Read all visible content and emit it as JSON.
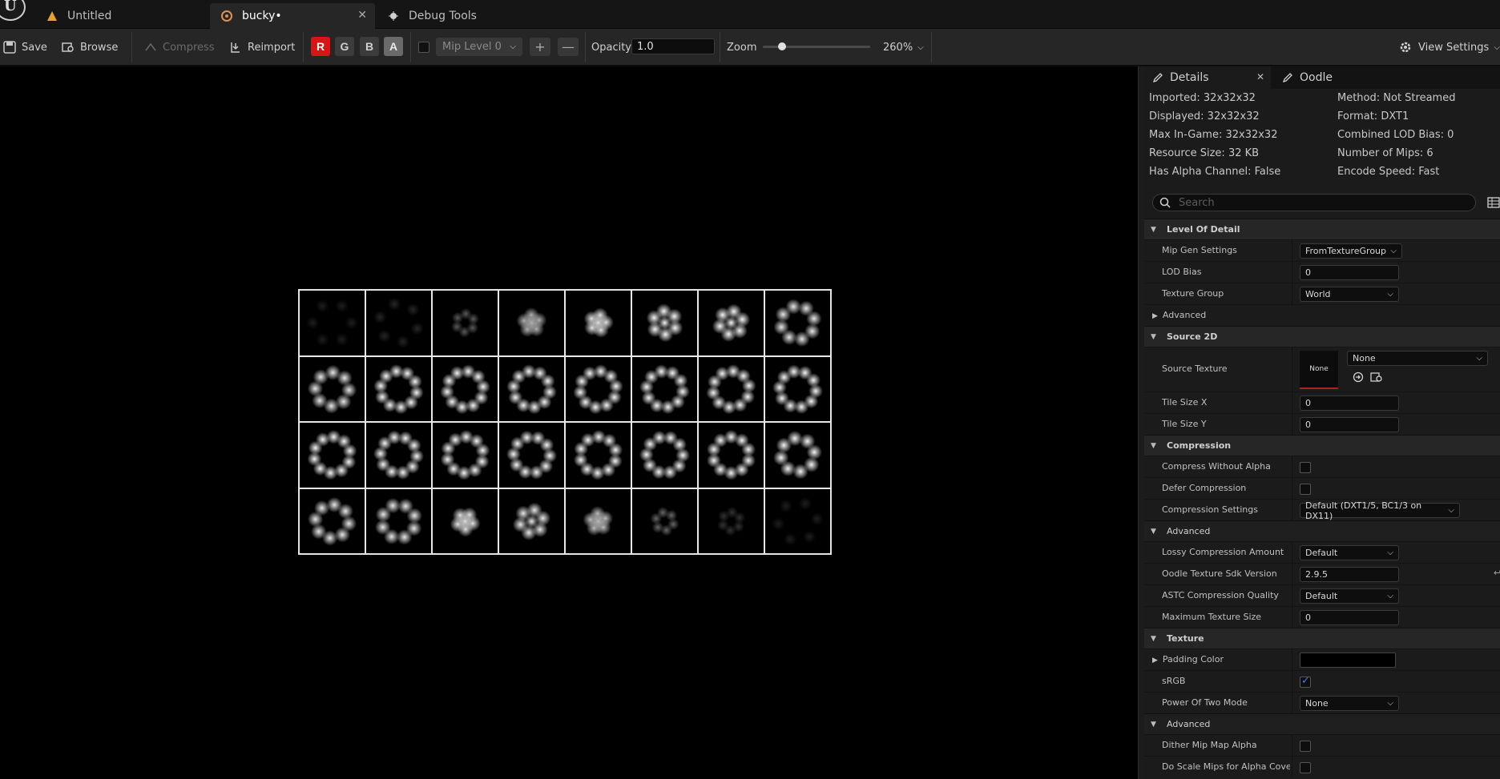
{
  "tabs": [
    {
      "label": "Untitled"
    },
    {
      "label": "bucky•"
    },
    {
      "label": "Debug Tools"
    }
  ],
  "toolbar": {
    "save": "Save",
    "browse": "Browse",
    "compress": "Compress",
    "reimport": "Reimport",
    "channels": [
      "R",
      "G",
      "B",
      "A"
    ],
    "mip_level": "Mip Level 0",
    "opacity_label": "Opacity",
    "opacity_value": "1.0",
    "zoom_label": "Zoom",
    "zoom_slider_fraction": 0.18,
    "zoom_value": "260%",
    "view_settings": "View Settings"
  },
  "colors": {
    "accent_blue": "#2a88ff",
    "channel_r": "#d81414",
    "panel_bg": "#1b1b1b",
    "viewport_bg": "#000000"
  },
  "panel": {
    "tabs": [
      "Details",
      "Oodle"
    ],
    "info_left": [
      "Imported: 32x32x32",
      "Displayed: 32x32x32",
      "Max In-Game: 32x32x32",
      "Resource Size: 32 KB",
      "Has Alpha Channel: False"
    ],
    "info_right": [
      "Method: Not Streamed",
      "Format: DXT1",
      "Combined LOD Bias: 0",
      "Number of Mips: 6",
      "Encode Speed: Fast"
    ],
    "search_placeholder": "Search",
    "sections": {
      "lod": {
        "title": "Level Of Detail",
        "mip_gen_label": "Mip Gen Settings",
        "mip_gen_value": "FromTextureGroup",
        "lod_bias_label": "LOD Bias",
        "lod_bias_value": "0",
        "texture_group_label": "Texture Group",
        "texture_group_value": "World",
        "advanced": "Advanced"
      },
      "source2d": {
        "title": "Source 2D",
        "source_texture_label": "Source Texture",
        "thumb": "None",
        "source_value": "None",
        "tile_x_label": "Tile Size X",
        "tile_x_value": "0",
        "tile_y_label": "Tile Size Y",
        "tile_y_value": "0"
      },
      "compression": {
        "title": "Compression",
        "without_alpha": "Compress Without Alpha",
        "defer": "Defer Compression",
        "settings_label": "Compression Settings",
        "settings_value": "Default (DXT1/5, BC1/3 on DX11)",
        "advanced": "Advanced",
        "lossy_label": "Lossy Compression Amount",
        "lossy_value": "Default",
        "oodle_label": "Oodle Texture Sdk Version",
        "oodle_value": "2.9.5",
        "astc_label": "ASTC Compression Quality",
        "astc_value": "Default",
        "max_size_label": "Maximum Texture Size",
        "max_size_value": "0"
      },
      "texture": {
        "title": "Texture",
        "padding_label": "Padding Color",
        "srgb_label": "sRGB",
        "pow2_label": "Power Of Two Mode",
        "pow2_value": "None",
        "advanced": "Advanced",
        "dither_label": "Dither Mip Map Alpha",
        "scale_mips_label": "Do Scale Mips for Alpha Cove..."
      }
    }
  },
  "texture_slices": {
    "rows": 4,
    "cols": 8,
    "pattern": [
      "none",
      "none",
      "ring3",
      "star5",
      "star5",
      "star6",
      "star6",
      "ring6",
      "ring6",
      "ring8",
      "ring8",
      "ring8",
      "ring8",
      "ring8",
      "ring8",
      "ring8",
      "ring8",
      "ring8",
      "ring8",
      "ring8",
      "ring8",
      "ring8",
      "ring8",
      "ring6",
      "ring6",
      "ring6",
      "star5",
      "star6",
      "star5",
      "ring3",
      "ring3",
      "none"
    ],
    "intensity": [
      0.12,
      0.15,
      0.35,
      0.7,
      0.9,
      0.95,
      0.95,
      0.9,
      0.9,
      0.95,
      0.95,
      0.95,
      0.95,
      0.95,
      0.95,
      0.95,
      0.95,
      0.95,
      0.95,
      0.95,
      0.95,
      0.95,
      0.95,
      0.95,
      0.9,
      0.9,
      0.9,
      0.9,
      0.75,
      0.4,
      0.2,
      0.12
    ]
  }
}
